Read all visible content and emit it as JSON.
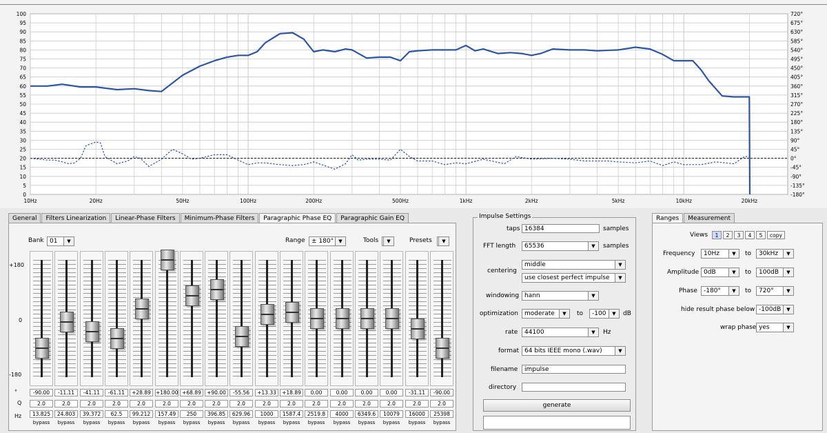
{
  "colors": {
    "curve": "#2b55a8",
    "grid": "#c6c6c6",
    "plot_bg": "#f3f3f3"
  },
  "chart_data": {
    "type": "line",
    "x_scale": "log",
    "x_ticks": [
      "10Hz",
      "20Hz",
      "50Hz",
      "100Hz",
      "200Hz",
      "500Hz",
      "1kHz",
      "2kHz",
      "5kHz",
      "10kHz",
      "20kHz"
    ],
    "x_tick_values": [
      10,
      20,
      50,
      100,
      200,
      500,
      1000,
      2000,
      5000,
      10000,
      20000
    ],
    "y_left_ticks": [
      "100",
      "95",
      "90",
      "85",
      "80",
      "75",
      "70",
      "65",
      "60",
      "55",
      "50",
      "45",
      "40",
      "35",
      "30",
      "25",
      "20",
      "15",
      "10",
      "5",
      "0"
    ],
    "y_right_ticks": [
      "720°",
      "675°",
      "630°",
      "585°",
      "540°",
      "495°",
      "450°",
      "405°",
      "360°",
      "315°",
      "270°",
      "225°",
      "180°",
      "135°",
      "90°",
      "45°",
      "0°",
      "-45°",
      "-90°",
      "-135°",
      "-180°"
    ],
    "ylim": [
      0,
      100
    ],
    "y2lim": [
      -180,
      720
    ],
    "grid": true,
    "series": [
      {
        "kind": "amplitude",
        "x": [
          10,
          12,
          14,
          17,
          20,
          25,
          30,
          35,
          40,
          50,
          60,
          70,
          80,
          90,
          100,
          110,
          120,
          140,
          160,
          180,
          200,
          220,
          250,
          280,
          300,
          350,
          400,
          450,
          500,
          550,
          600,
          700,
          800,
          900,
          1000,
          1100,
          1200,
          1400,
          1600,
          1800,
          2000,
          2200,
          2500,
          3000,
          3500,
          4000,
          5000,
          6000,
          7000,
          8000,
          9000,
          10000,
          11000,
          12000,
          13000,
          15000,
          17000,
          19000,
          20000,
          20100
        ],
        "y": [
          60,
          60,
          61,
          59.5,
          59.5,
          58,
          58.5,
          57.5,
          57,
          66,
          71,
          74,
          76,
          77,
          77,
          79,
          84,
          89,
          89.5,
          86,
          79,
          80,
          79,
          80.5,
          80,
          75.5,
          76,
          76,
          74,
          79,
          79.5,
          80,
          80,
          80,
          82.5,
          79.5,
          80.5,
          78,
          78.5,
          78,
          77,
          78,
          80.5,
          80,
          80,
          79.5,
          80,
          81.5,
          80.5,
          77.5,
          74,
          74,
          74,
          69,
          63,
          54.5,
          54,
          54,
          54,
          0
        ]
      },
      {
        "kind": "phase",
        "x": [
          10,
          11,
          12,
          13,
          14,
          15,
          16,
          17,
          18,
          20,
          21,
          22,
          25,
          28,
          30,
          32,
          35,
          40,
          45,
          50,
          55,
          60,
          70,
          80,
          90,
          100,
          110,
          120,
          140,
          160,
          180,
          200,
          250,
          280,
          300,
          320,
          350,
          400,
          450,
          500,
          550,
          600,
          700,
          800,
          900,
          1000,
          1200,
          1500,
          1700,
          2000,
          2500,
          3000,
          3500,
          4000,
          4500,
          5000,
          6000,
          7000,
          8000,
          9000,
          10000,
          12000,
          14000,
          17000,
          19000,
          20000
        ],
        "y": [
          20,
          19.5,
          19,
          19,
          18,
          17,
          17.5,
          20,
          27,
          29,
          28.5,
          21,
          17,
          18.5,
          21,
          20,
          15.5,
          19.5,
          25,
          22.5,
          19.5,
          20,
          22,
          22,
          19,
          16.5,
          17.5,
          17.5,
          16.5,
          16,
          16.5,
          18,
          14,
          17,
          22,
          19,
          19.5,
          19.5,
          19,
          25,
          21,
          18.5,
          18.5,
          16.5,
          17.5,
          17,
          19.5,
          17,
          21,
          19.5,
          20,
          19.5,
          18.5,
          18.5,
          18.5,
          18,
          17.5,
          18.5,
          16,
          18,
          16.5,
          16.5,
          18,
          17,
          21,
          21
        ]
      }
    ]
  },
  "left_tabs": [
    "General",
    "Filters Linearization",
    "Linear-Phase Filters",
    "Minimum-Phase Filters",
    "Paragraphic Phase EQ",
    "Paragraphic Gain EQ"
  ],
  "eq": {
    "bank_label": "Bank",
    "bank_value": "01",
    "range_label": "Range",
    "range_value": "± 180°",
    "tools_label": "Tools",
    "presets_label": "Presets",
    "scale_top": "+180",
    "scale_mid": "0",
    "scale_bottom": "-180",
    "row_labels": [
      "°",
      "Q",
      "Hz"
    ],
    "bypass_label": "bypass",
    "bands": [
      {
        "deg": -90,
        "deg_text": "-90.00",
        "q": "2.0",
        "hz": "13.825"
      },
      {
        "deg": -11.11,
        "deg_text": "-11.11",
        "q": "2.0",
        "hz": "24.803"
      },
      {
        "deg": -41.11,
        "deg_text": "-41.11",
        "q": "2.0",
        "hz": "39.372"
      },
      {
        "deg": -61.11,
        "deg_text": "-61.11",
        "q": "2.0",
        "hz": "62.5"
      },
      {
        "deg": 28.89,
        "deg_text": "+28.89",
        "q": "2.0",
        "hz": "99.212"
      },
      {
        "deg": 180,
        "deg_text": "+180.00",
        "q": "2.0",
        "hz": "157.49"
      },
      {
        "deg": 68.89,
        "deg_text": "+68.89",
        "q": "2.0",
        "hz": "250"
      },
      {
        "deg": 90,
        "deg_text": "+90.00",
        "q": "2.0",
        "hz": "396.85"
      },
      {
        "deg": -55.56,
        "deg_text": "-55.56",
        "q": "2.0",
        "hz": "629.96"
      },
      {
        "deg": 13.33,
        "deg_text": "+13.33",
        "q": "2.0",
        "hz": "1000"
      },
      {
        "deg": 18.89,
        "deg_text": "+18.89",
        "q": "2.0",
        "hz": "1587.4"
      },
      {
        "deg": 0,
        "deg_text": "0.00",
        "q": "2.0",
        "hz": "2519.8"
      },
      {
        "deg": 0,
        "deg_text": "0.00",
        "q": "2.0",
        "hz": "4000"
      },
      {
        "deg": 0,
        "deg_text": "0.00",
        "q": "2.0",
        "hz": "6349.6"
      },
      {
        "deg": 0,
        "deg_text": "0.00",
        "q": "2.0",
        "hz": "10079"
      },
      {
        "deg": -31.11,
        "deg_text": "-31.11",
        "q": "2.0",
        "hz": "16000"
      },
      {
        "deg": -90,
        "deg_text": "-90.00",
        "q": "2.0",
        "hz": "25398"
      }
    ]
  },
  "impulse": {
    "title": "Impulse Settings",
    "taps_label": "taps",
    "taps_value": "16384",
    "taps_unit": "samples",
    "fft_label": "FFT length",
    "fft_value": "65536",
    "fft_unit": "samples",
    "centering_label": "centering",
    "centering_value": "middle",
    "centering_value2": "use closest perfect impulse",
    "windowing_label": "windowing",
    "windowing_value": "hann",
    "optimization_label": "optimization",
    "optimization_value": "moderate",
    "optimization_to": "to",
    "optimization_db_value": "-100",
    "optimization_unit": "dB",
    "rate_label": "rate",
    "rate_value": "44100",
    "rate_unit": "Hz",
    "format_label": "format",
    "format_value": "64 bits IEEE mono (.wav)",
    "filename_label": "filename",
    "filename_value": "impulse",
    "directory_label": "directory",
    "directory_value": "",
    "generate_label": "generate"
  },
  "right_tabs": [
    "Ranges",
    "Measurement"
  ],
  "ranges": {
    "views_label": "Views",
    "views": [
      "1",
      "2",
      "3",
      "4",
      "5"
    ],
    "views_active": "1",
    "copy_label": "copy",
    "frequency_label": "Frequency",
    "frequency_from": "10Hz",
    "frequency_to": "30kHz",
    "amplitude_label": "Amplitude",
    "amplitude_from": "0dB",
    "amplitude_to": "100dB",
    "phase_label": "Phase",
    "phase_from": "-180°",
    "phase_to": "720°",
    "to_label": "to",
    "hide_label": "hide result phase below",
    "hide_value": "-100dB",
    "wrap_label": "wrap phase",
    "wrap_value": "yes"
  }
}
